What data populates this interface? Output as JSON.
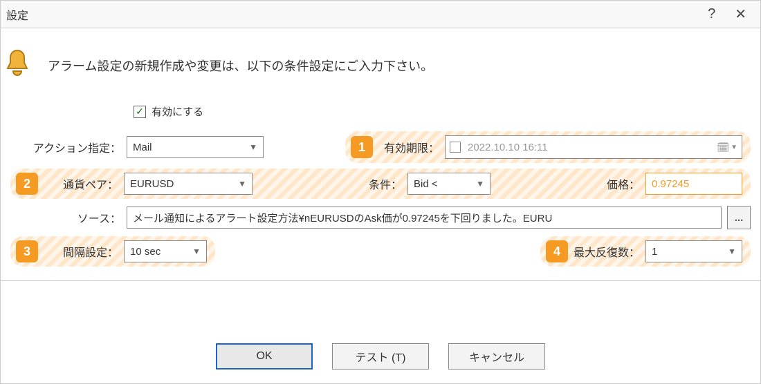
{
  "window": {
    "title": "設定"
  },
  "header": {
    "instruction": "アラーム設定の新規作成や変更は、以下の条件設定にご入力下さい。"
  },
  "enable": {
    "label": "有効にする",
    "checked": true
  },
  "badges": {
    "b1": "1",
    "b2": "2",
    "b3": "3",
    "b4": "4"
  },
  "labels": {
    "action": "アクション指定：",
    "expiry": "有効期限：",
    "pair": "通貨ペア：",
    "condition": "条件：",
    "price": "価格：",
    "source": "ソース：",
    "interval": "間隔設定：",
    "maxrepeat": "最大反復数："
  },
  "values": {
    "action": "Mail",
    "expiry_date": "2022.10.10 16:11",
    "pair": "EURUSD",
    "condition": "Bid <",
    "price": "0.97245",
    "source_text": "メール通知によるアラート設定方法¥nEURUSDのAsk価が0.97245を下回りました。EURU",
    "interval": "10 sec",
    "maxrepeat": "1"
  },
  "buttons": {
    "ok": "OK",
    "test": "テスト (T)",
    "cancel": "キャンセル",
    "more": "..."
  }
}
